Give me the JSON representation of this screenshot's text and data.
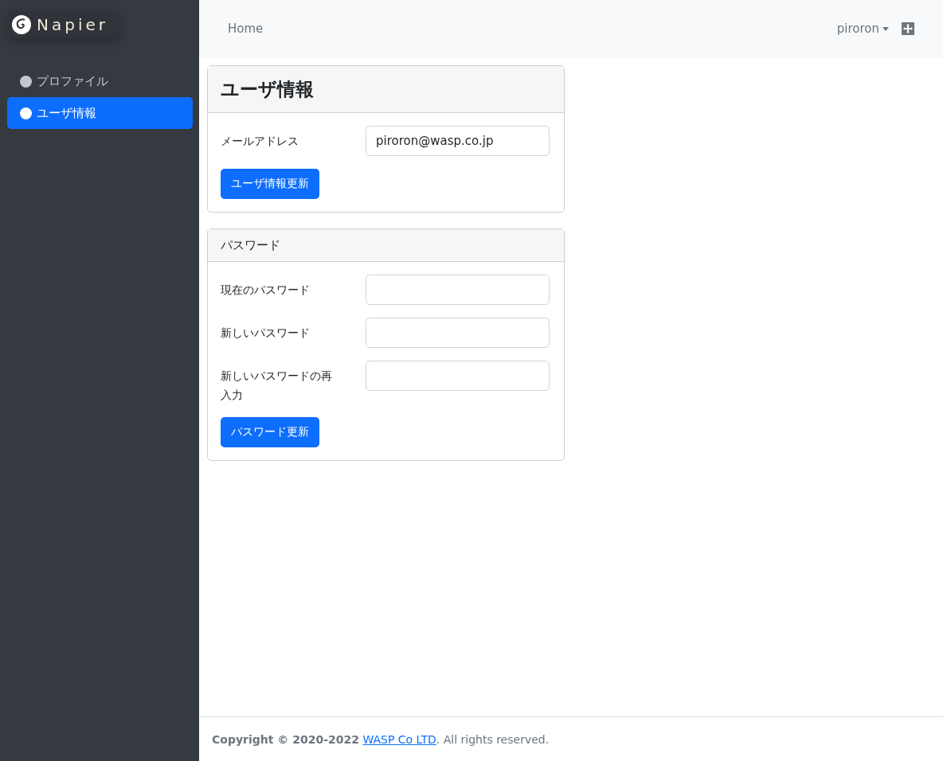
{
  "sidebar": {
    "brand": "Napier",
    "items": [
      {
        "label": "プロファイル",
        "selected": false
      },
      {
        "label": "ユーザ情報",
        "selected": true
      }
    ]
  },
  "navbar": {
    "home": "Home",
    "user": "piroron"
  },
  "cards": [
    {
      "title": "ユーザ情報",
      "kind": "large",
      "fields": [
        {
          "label": "メールアドレス",
          "value": "piroron@wasp.co.jp"
        }
      ],
      "button": "ユーザ情報更新"
    },
    {
      "title": "パスワード",
      "kind": "small",
      "fields": [
        {
          "label": "現在のパスワード"
        },
        {
          "label": "新しいパスワード"
        },
        {
          "label": "新しいパスワードの再入力"
        }
      ],
      "button": "パスワード更新"
    }
  ],
  "footer": {
    "prefix": "**Copyright © 2020-2022** ",
    "link": "WASP Co LTD",
    "suffix": ". All rights reserved."
  }
}
